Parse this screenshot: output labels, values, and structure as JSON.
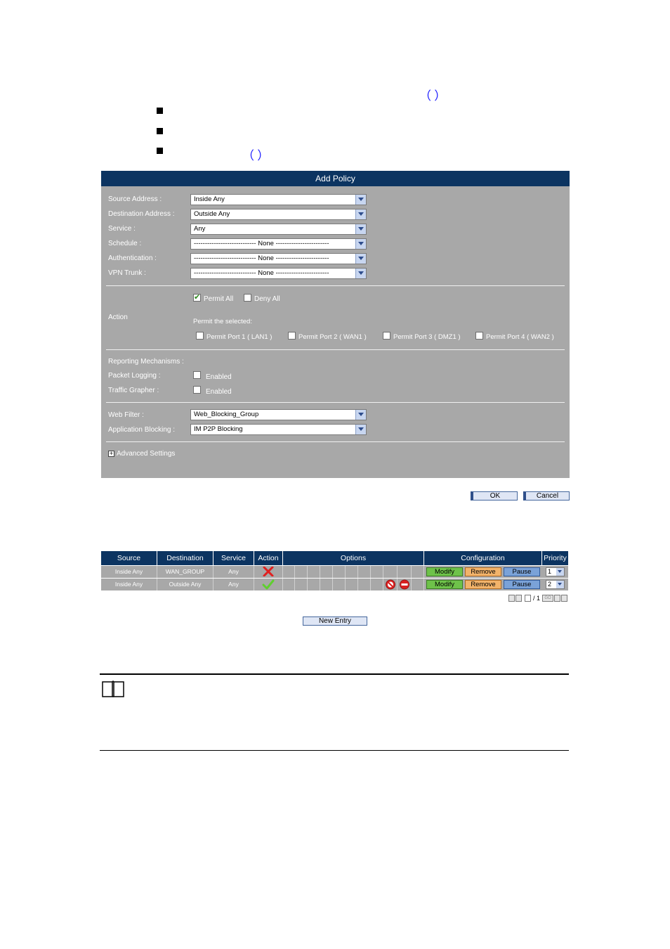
{
  "doc": {
    "intro_paren": "（          ）",
    "bullet3_paren": "（          ）"
  },
  "add_policy": {
    "title": "Add Policy",
    "fields": [
      {
        "label": "Source Address :",
        "value": "Inside Any"
      },
      {
        "label": "Destination Address :",
        "value": "Outside Any"
      },
      {
        "label": "Service :",
        "value": "Any"
      },
      {
        "label": "Schedule :",
        "value": "---------------------------- None ------------------------"
      },
      {
        "label": "Authentication :",
        "value": "---------------------------- None ------------------------"
      },
      {
        "label": "VPN Trunk :",
        "value": "---------------------------- None ------------------------"
      }
    ],
    "action": {
      "label": "Action",
      "permit_all": {
        "label": "Permit All",
        "checked": true
      },
      "deny_all": {
        "label": "Deny All",
        "checked": false
      },
      "permit_selected_text": "Permit the selected:",
      "ports": [
        {
          "label": "Permit Port  1  ( LAN1 )",
          "checked": false
        },
        {
          "label": "Permit Port  2  ( WAN1 )",
          "checked": false
        },
        {
          "label": "Permit Port  3  ( DMZ1 )",
          "checked": false
        },
        {
          "label": "Permit Port  4  ( WAN2 )",
          "checked": false
        }
      ]
    },
    "reporting": {
      "title": "Reporting Mechanisms :",
      "packet_logging": {
        "label": "Packet Logging :",
        "option": "Enabled",
        "checked": false
      },
      "traffic_grapher": {
        "label": "Traffic Grapher :",
        "option": "Enabled",
        "checked": false
      }
    },
    "web_filter": {
      "label": "Web Filter :",
      "value": "Web_Blocking_Group"
    },
    "app_blocking": {
      "label": "Application Blocking :",
      "value": "IM P2P Blocking"
    },
    "advanced": "Advanced Settings",
    "ok_label": "OK",
    "cancel_label": "Cancel"
  },
  "policy_table": {
    "headers": {
      "source": "Source",
      "destination": "Destination",
      "service": "Service",
      "action": "Action",
      "options": "Options",
      "configuration": "Configuration",
      "priority": "Priority"
    },
    "rows": [
      {
        "source": "Inside Any",
        "destination": "WAN_GROUP",
        "service": "Any",
        "action_icon": "deny-x-icon",
        "modify": "Modify",
        "remove": "Remove",
        "pause": "Pause",
        "priority": "1"
      },
      {
        "source": "Inside Any",
        "destination": "Outside Any",
        "service": "Any",
        "action_icon": "permit-check-icon",
        "modify": "Modify",
        "remove": "Remove",
        "pause": "Pause",
        "priority": "2"
      }
    ],
    "pager": {
      "of": "/ 1",
      "go": "GO"
    },
    "new_entry": "New Entry"
  },
  "colors": {
    "header_bg": "#0c3461",
    "panel_bg": "#a8a8a8",
    "modify": "#6ec24a",
    "remove": "#f2b36a",
    "pause": "#7aa2d8"
  }
}
